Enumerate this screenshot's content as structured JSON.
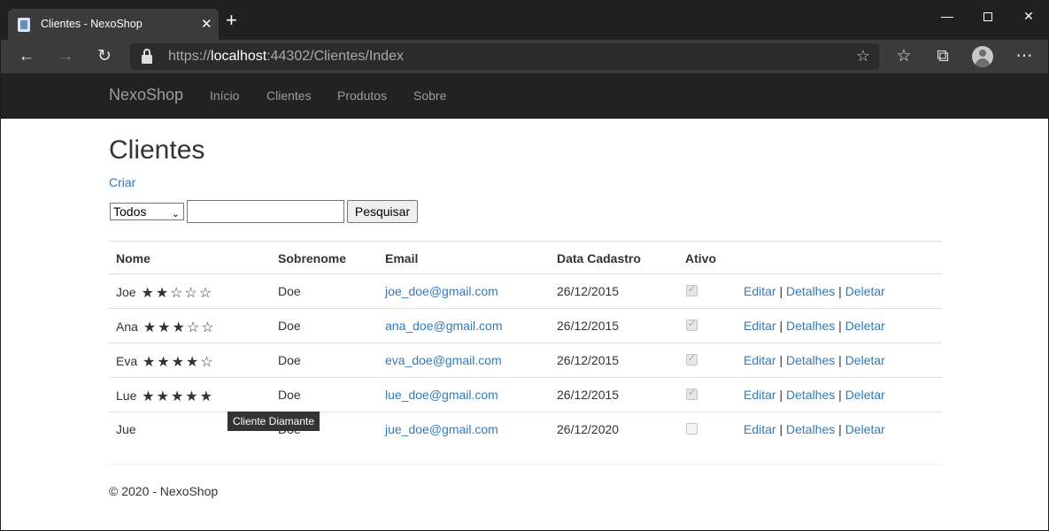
{
  "browser": {
    "tab_title": "Clientes - NexoShop",
    "url_scheme": "https://",
    "url_host": "localhost",
    "url_rest": ":44302/Clientes/Index"
  },
  "nav": {
    "brand": "NexoShop",
    "links": [
      "Início",
      "Clientes",
      "Produtos",
      "Sobre"
    ]
  },
  "page": {
    "title": "Clientes",
    "create_link": "Criar",
    "filter_selected": "Todos",
    "search_value": "",
    "search_button": "Pesquisar"
  },
  "table": {
    "headers": [
      "Nome",
      "Sobrenome",
      "Email",
      "Data Cadastro",
      "Ativo"
    ],
    "rows": [
      {
        "nome": "Joe",
        "stars": 2,
        "sobrenome": "Doe",
        "email": "joe_doe@gmail.com",
        "data": "26/12/2015",
        "ativo": true
      },
      {
        "nome": "Ana",
        "stars": 3,
        "sobrenome": "Doe",
        "email": "ana_doe@gmail.com",
        "data": "26/12/2015",
        "ativo": true
      },
      {
        "nome": "Eva",
        "stars": 4,
        "sobrenome": "Doe",
        "email": "eva_doe@gmail.com",
        "data": "26/12/2015",
        "ativo": true
      },
      {
        "nome": "Lue",
        "stars": 5,
        "sobrenome": "Doe",
        "email": "lue_doe@gmail.com",
        "data": "26/12/2015",
        "ativo": true
      },
      {
        "nome": "Jue",
        "stars": 0,
        "sobrenome": "Doe",
        "email": "jue_doe@gmail.com",
        "data": "26/12/2020",
        "ativo": false
      }
    ],
    "actions": [
      "Editar",
      "Detalhes",
      "Deletar"
    ]
  },
  "tooltip": "Cliente Diamante",
  "footer": "© 2020 - NexoShop"
}
